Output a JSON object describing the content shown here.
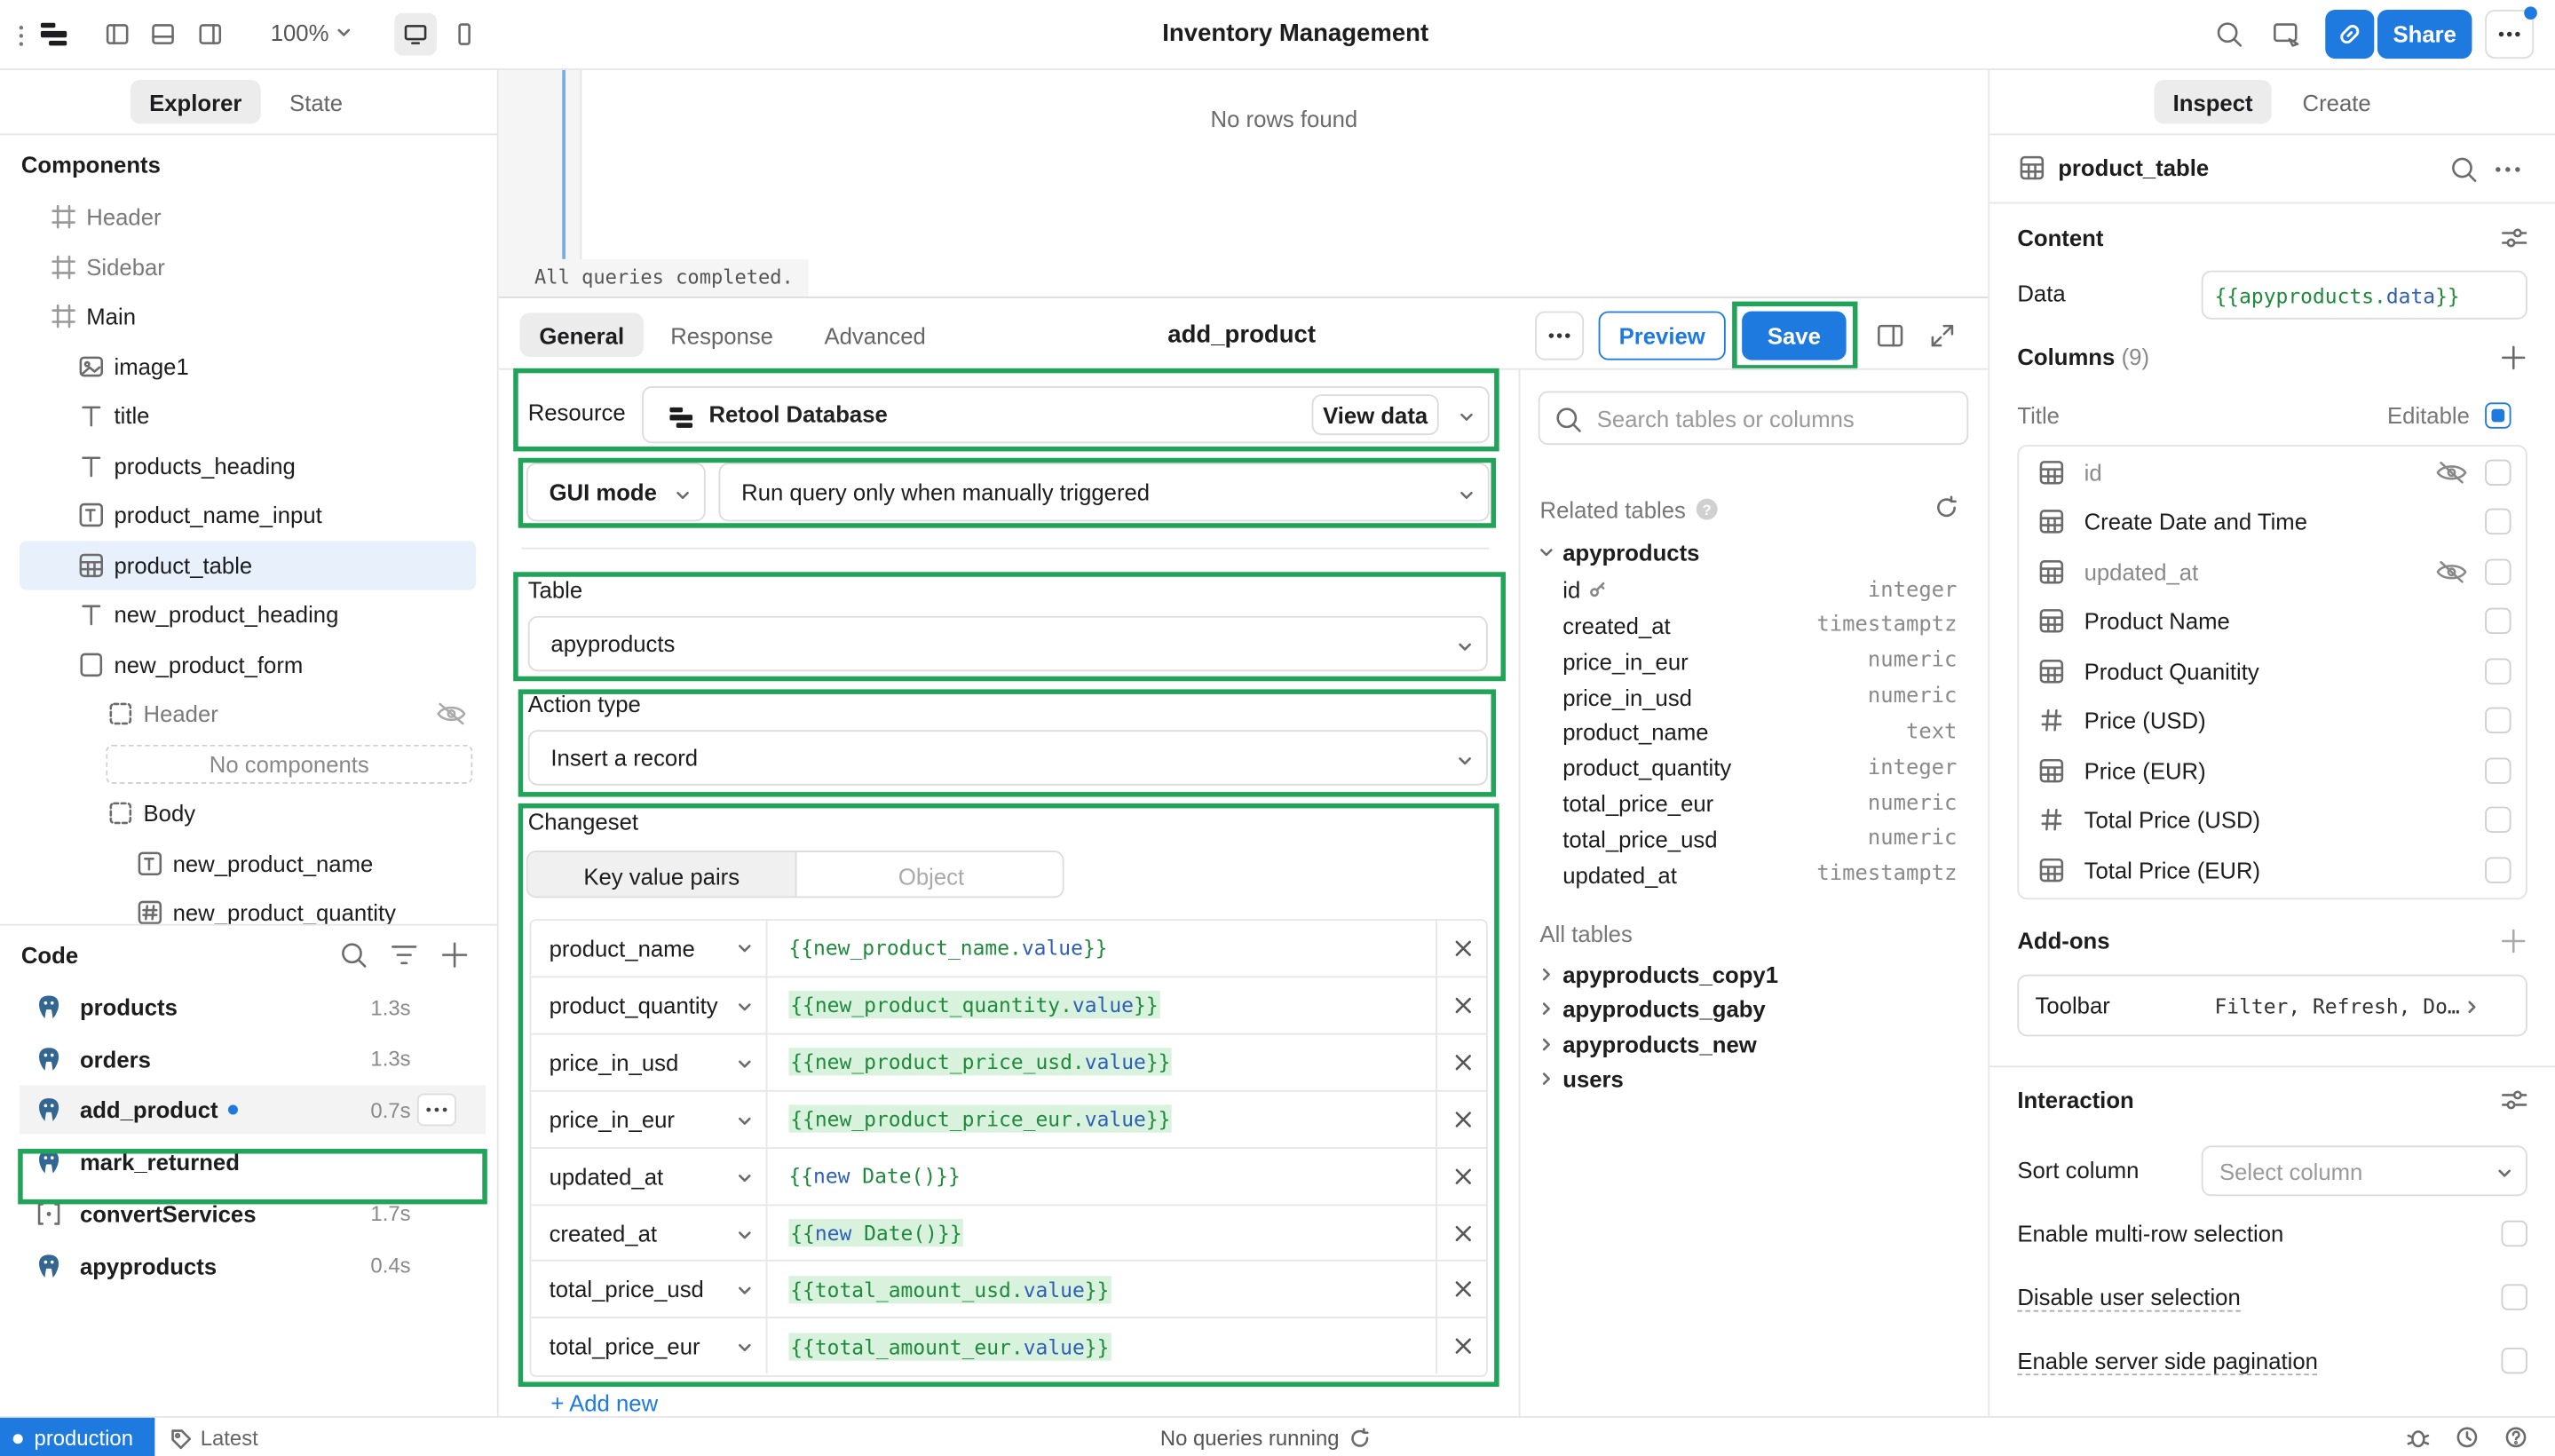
{
  "topbar": {
    "zoom": "100%",
    "title": "Inventory Management",
    "share_label": "Share"
  },
  "left": {
    "tabs": [
      "Explorer",
      "State"
    ],
    "components_heading": "Components",
    "tree": [
      {
        "label": "Header",
        "icon": "frame-icon",
        "muted": true
      },
      {
        "label": "Sidebar",
        "icon": "frame-icon",
        "muted": true
      },
      {
        "label": "Main",
        "icon": "frame-icon",
        "muted": false
      },
      {
        "label": "image1",
        "icon": "image-icon",
        "muted": false
      },
      {
        "label": "title",
        "icon": "text-icon",
        "muted": false
      },
      {
        "label": "products_heading",
        "icon": "text-icon",
        "muted": false
      },
      {
        "label": "product_name_input",
        "icon": "text-input-icon",
        "muted": false
      },
      {
        "label": "product_table",
        "icon": "table-icon",
        "muted": false
      },
      {
        "label": "new_product_heading",
        "icon": "text-icon",
        "muted": false
      },
      {
        "label": "new_product_form",
        "icon": "form-icon",
        "muted": false
      },
      {
        "label": "Header",
        "icon": "container-icon",
        "muted": true
      },
      {
        "label": "No components",
        "icon": "",
        "muted": true
      },
      {
        "label": "Body",
        "icon": "container-icon",
        "muted": false
      },
      {
        "label": "new_product_name",
        "icon": "text-input-icon",
        "muted": false
      },
      {
        "label": "new_product_quantity",
        "icon": "number-input-icon",
        "muted": false
      }
    ],
    "code_heading": "Code",
    "queries": [
      {
        "name": "products",
        "time": "1.3s",
        "icon": "postgres-icon"
      },
      {
        "name": "orders",
        "time": "1.3s",
        "icon": "postgres-icon"
      },
      {
        "name": "add_product",
        "time": "0.7s",
        "icon": "postgres-icon"
      },
      {
        "name": "mark_returned",
        "time": "",
        "icon": "postgres-icon"
      },
      {
        "name": "convertServices",
        "time": "1.7s",
        "icon": "code-icon"
      },
      {
        "name": "apyproducts",
        "time": "0.4s",
        "icon": "postgres-icon"
      }
    ]
  },
  "canvas": {
    "empty_text": "No rows found",
    "console_text": "All queries completed."
  },
  "editor": {
    "tabs": [
      "General",
      "Response",
      "Advanced"
    ],
    "query_name": "add_product",
    "preview_label": "Preview",
    "save_label": "Save",
    "resource_label": "Resource",
    "resource_value": "Retool Database",
    "view_data_label": "View data",
    "mode_value": "GUI mode",
    "trigger_value": "Run query only when manually triggered",
    "table_label": "Table",
    "table_value": "apyproducts",
    "action_label": "Action type",
    "action_value": "Insert a record",
    "changeset_label": "Changeset",
    "changeset_tabs": [
      "Key value pairs",
      "Object"
    ],
    "changeset": [
      {
        "key": "product_name",
        "pre": "{{new_product_name.",
        "kw": "value",
        "post": "}}",
        "style": "plain"
      },
      {
        "key": "product_quantity",
        "pre": "{{new_product_quantity.",
        "kw": "value",
        "post": "}}",
        "style": "hl"
      },
      {
        "key": "price_in_usd",
        "pre": "{{new_product_price_usd.",
        "kw": "value",
        "post": "}}",
        "style": "hl"
      },
      {
        "key": "price_in_eur",
        "pre": "{{new_product_price_eur.",
        "kw": "value",
        "post": "}}",
        "style": "hl"
      },
      {
        "key": "updated_at",
        "pre": "{{",
        "kw": "new",
        "post": " Date()}}",
        "style": "plain"
      },
      {
        "key": "created_at",
        "pre": "{{",
        "kw": "new",
        "post": " Date()}}",
        "style": "hl"
      },
      {
        "key": "total_price_usd",
        "pre": "{{total_amount_usd.",
        "kw": "value",
        "post": "}}",
        "style": "hl"
      },
      {
        "key": "total_price_eur",
        "pre": "{{total_amount_eur.",
        "kw": "value",
        "post": "}}",
        "style": "hl"
      }
    ],
    "add_new_label": "+ Add new"
  },
  "schema": {
    "search_placeholder": "Search tables or columns",
    "related_heading": "Related tables",
    "related_table": "apyproducts",
    "columns": [
      {
        "name": "id",
        "type": "integer"
      },
      {
        "name": "created_at",
        "type": "timestamptz"
      },
      {
        "name": "price_in_eur",
        "type": "numeric"
      },
      {
        "name": "price_in_usd",
        "type": "numeric"
      },
      {
        "name": "product_name",
        "type": "text"
      },
      {
        "name": "product_quantity",
        "type": "integer"
      },
      {
        "name": "total_price_eur",
        "type": "numeric"
      },
      {
        "name": "total_price_usd",
        "type": "numeric"
      },
      {
        "name": "updated_at",
        "type": "timestamptz"
      }
    ],
    "all_heading": "All tables",
    "all_tables": [
      "apyproducts_copy1",
      "apyproducts_gaby",
      "apyproducts_new",
      "users"
    ]
  },
  "inspector": {
    "tabs": [
      "Inspect",
      "Create"
    ],
    "component_name": "product_table",
    "content_heading": "Content",
    "data_label": "Data",
    "data_value": "{{apyproducts.data}}",
    "data_pre": "{{apyproducts.",
    "data_kw": "data",
    "data_post": "}}",
    "columns_label": "Columns",
    "columns_count": "(9)",
    "title_label": "Title",
    "editable_label": "Editable",
    "columns": [
      {
        "label": "id",
        "icon": "column-icon",
        "hidden": true
      },
      {
        "label": "Create Date and Time",
        "icon": "column-icon",
        "hidden": false
      },
      {
        "label": "updated_at",
        "icon": "column-icon",
        "hidden": true
      },
      {
        "label": "Product Name",
        "icon": "column-icon",
        "hidden": false
      },
      {
        "label": "Product Quanitity",
        "icon": "column-icon",
        "hidden": false
      },
      {
        "label": "Price (USD)",
        "icon": "hash-icon",
        "hidden": false
      },
      {
        "label": "Price (EUR)",
        "icon": "column-icon",
        "hidden": false
      },
      {
        "label": "Total Price (USD)",
        "icon": "hash-icon",
        "hidden": false
      },
      {
        "label": "Total Price (EUR)",
        "icon": "column-icon",
        "hidden": false
      }
    ],
    "addons_label": "Add-ons",
    "toolbar_label": "Toolbar",
    "toolbar_value": "Filter, Refresh, Do…",
    "interaction_heading": "Interaction",
    "sort_label": "Sort column",
    "sort_placeholder": "Select column",
    "opts": [
      "Enable multi-row selection",
      "Disable user selection",
      "Enable server side pagination"
    ]
  },
  "statusbar": {
    "env": "production",
    "version": "Latest",
    "status": "No queries running"
  },
  "colors": {
    "accent": "#1f7ae0",
    "highlight": "#22a35a",
    "template_bg": "#d9f2dd"
  }
}
